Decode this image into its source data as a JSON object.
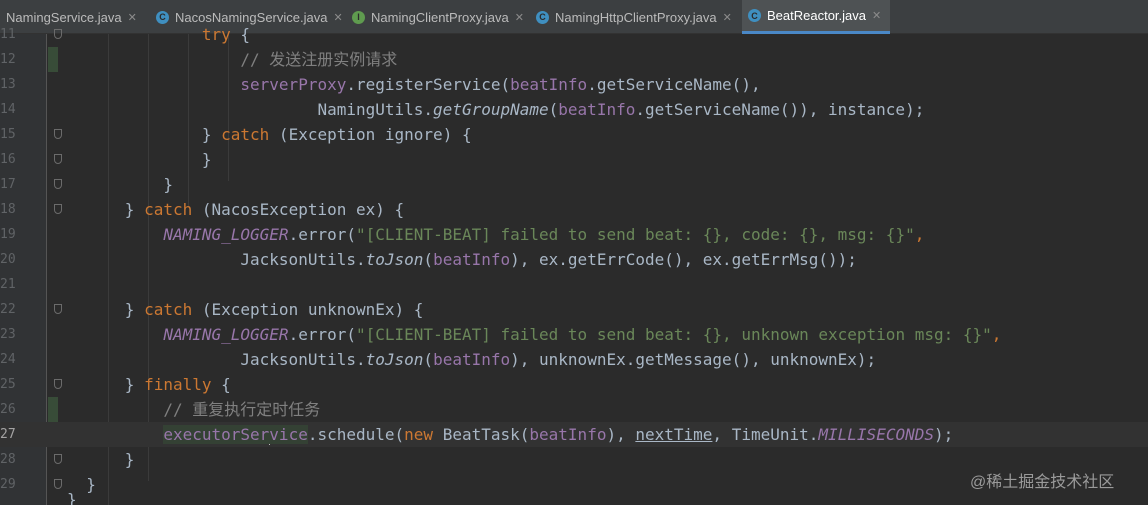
{
  "tabs": [
    {
      "label": "NamingService.java",
      "icon": "interface-icon"
    },
    {
      "label": "NacosNamingService.java",
      "icon": "class-icon"
    },
    {
      "label": "NamingClientProxy.java",
      "icon": "interface-icon"
    },
    {
      "label": "NamingHttpClientProxy.java",
      "icon": "class-icon"
    },
    {
      "label": "BeatReactor.java",
      "icon": "class-icon",
      "active": true
    }
  ],
  "line_numbers": [
    "11",
    "12",
    "13",
    "14",
    "15",
    "16",
    "17",
    "18",
    "19",
    "20",
    "21",
    "22",
    "23",
    "24",
    "25",
    "26",
    "27",
    "28",
    "29",
    ""
  ],
  "code": {
    "l11": {
      "kw": "try",
      "rest": " {"
    },
    "l12": {
      "comment": "// 发送注册实例请求"
    },
    "l13": {
      "field": "serverProxy",
      "mid": ".registerService(",
      "arg": "beatInfo",
      "tail": ".getServiceName(),"
    },
    "l14": {
      "a": "NamingUtils.",
      "b": "getGroupName",
      "c": "(",
      "d": "beatInfo",
      "e": ".getServiceName()), instance);"
    },
    "l15": {
      "a": "} ",
      "kw": "catch",
      "b": " (Exception ignore) {"
    },
    "l16": {
      "a": "}"
    },
    "l17": {
      "a": "}"
    },
    "l18": {
      "a": "} ",
      "kw": "catch",
      "b": " (NacosException ex) {"
    },
    "l19": {
      "logger": "NAMING_LOGGER",
      "mid": ".error(",
      "str": "\"[CLIENT-BEAT] failed to send beat: {}, code: {}, msg: {}\"",
      "end": ","
    },
    "l20": {
      "a": "JacksonUtils.",
      "b": "toJson",
      "c": "(",
      "d": "beatInfo",
      "e": "), ex.getErrCode(), ex.getErrMsg());"
    },
    "l22": {
      "a": "} ",
      "kw": "catch",
      "b": " (Exception unknownEx) {"
    },
    "l23": {
      "logger": "NAMING_LOGGER",
      "mid": ".error(",
      "str": "\"[CLIENT-BEAT] failed to send beat: {}, unknown exception msg: {}\"",
      "end": ","
    },
    "l24": {
      "a": "JacksonUtils.",
      "b": "toJson",
      "c": "(",
      "d": "beatInfo",
      "e": "), unknownEx.getMessage(), unknownEx);"
    },
    "l25": {
      "a": "} ",
      "kw": "finally",
      "b": " {"
    },
    "l26": {
      "comment": "// 重复执行定时任务"
    },
    "l27": {
      "f1": "executorSer",
      "f2": "vice",
      "a": ".schedule(",
      "kw": "new",
      "b": " BeatTask(",
      "c": "beatInfo",
      "d": "), ",
      "e": "nextTime",
      "f": ", TimeUnit.",
      "g": "MILLISECONDS",
      "h": ");"
    },
    "l28": {
      "a": "}"
    },
    "l29": {
      "a": "}"
    },
    "l30": {
      "a": "}"
    }
  },
  "watermark": "@稀土掘金技术社区"
}
